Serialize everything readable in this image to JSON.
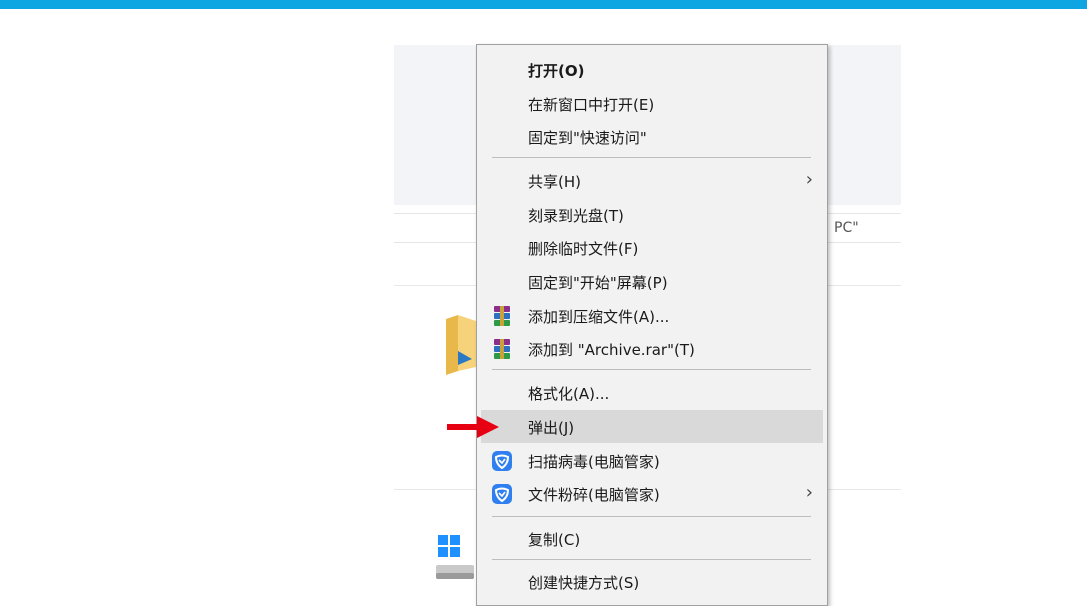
{
  "explorer": {
    "address_fragment": "PC\""
  },
  "menu": {
    "items": [
      {
        "label": "打开(O)"
      },
      {
        "label": "在新窗口中打开(E)"
      },
      {
        "label": "固定到\"快速访问\""
      },
      {
        "label": "共享(H)",
        "submenu": true
      },
      {
        "label": "刻录到光盘(T)"
      },
      {
        "label": "删除临时文件(F)"
      },
      {
        "label": "固定到\"开始\"屏幕(P)"
      },
      {
        "label": "添加到压缩文件(A)...",
        "icon": "winrar-icon"
      },
      {
        "label": "添加到 \"Archive.rar\"(T)",
        "icon": "winrar-icon"
      },
      {
        "label": "格式化(A)..."
      },
      {
        "label": "弹出(J)",
        "highlighted": true
      },
      {
        "label": "扫描病毒(电脑管家)",
        "icon": "tencent-pc-manager-icon"
      },
      {
        "label": "文件粉碎(电脑管家)",
        "icon": "tencent-pc-manager-icon",
        "submenu": true
      },
      {
        "label": "复制(C)"
      },
      {
        "label": "创建快捷方式(S)"
      }
    ]
  },
  "colors": {
    "topbar": "#0ea5e3",
    "highlight": "#d9d9d9",
    "annotation_arrow": "#e60012"
  }
}
